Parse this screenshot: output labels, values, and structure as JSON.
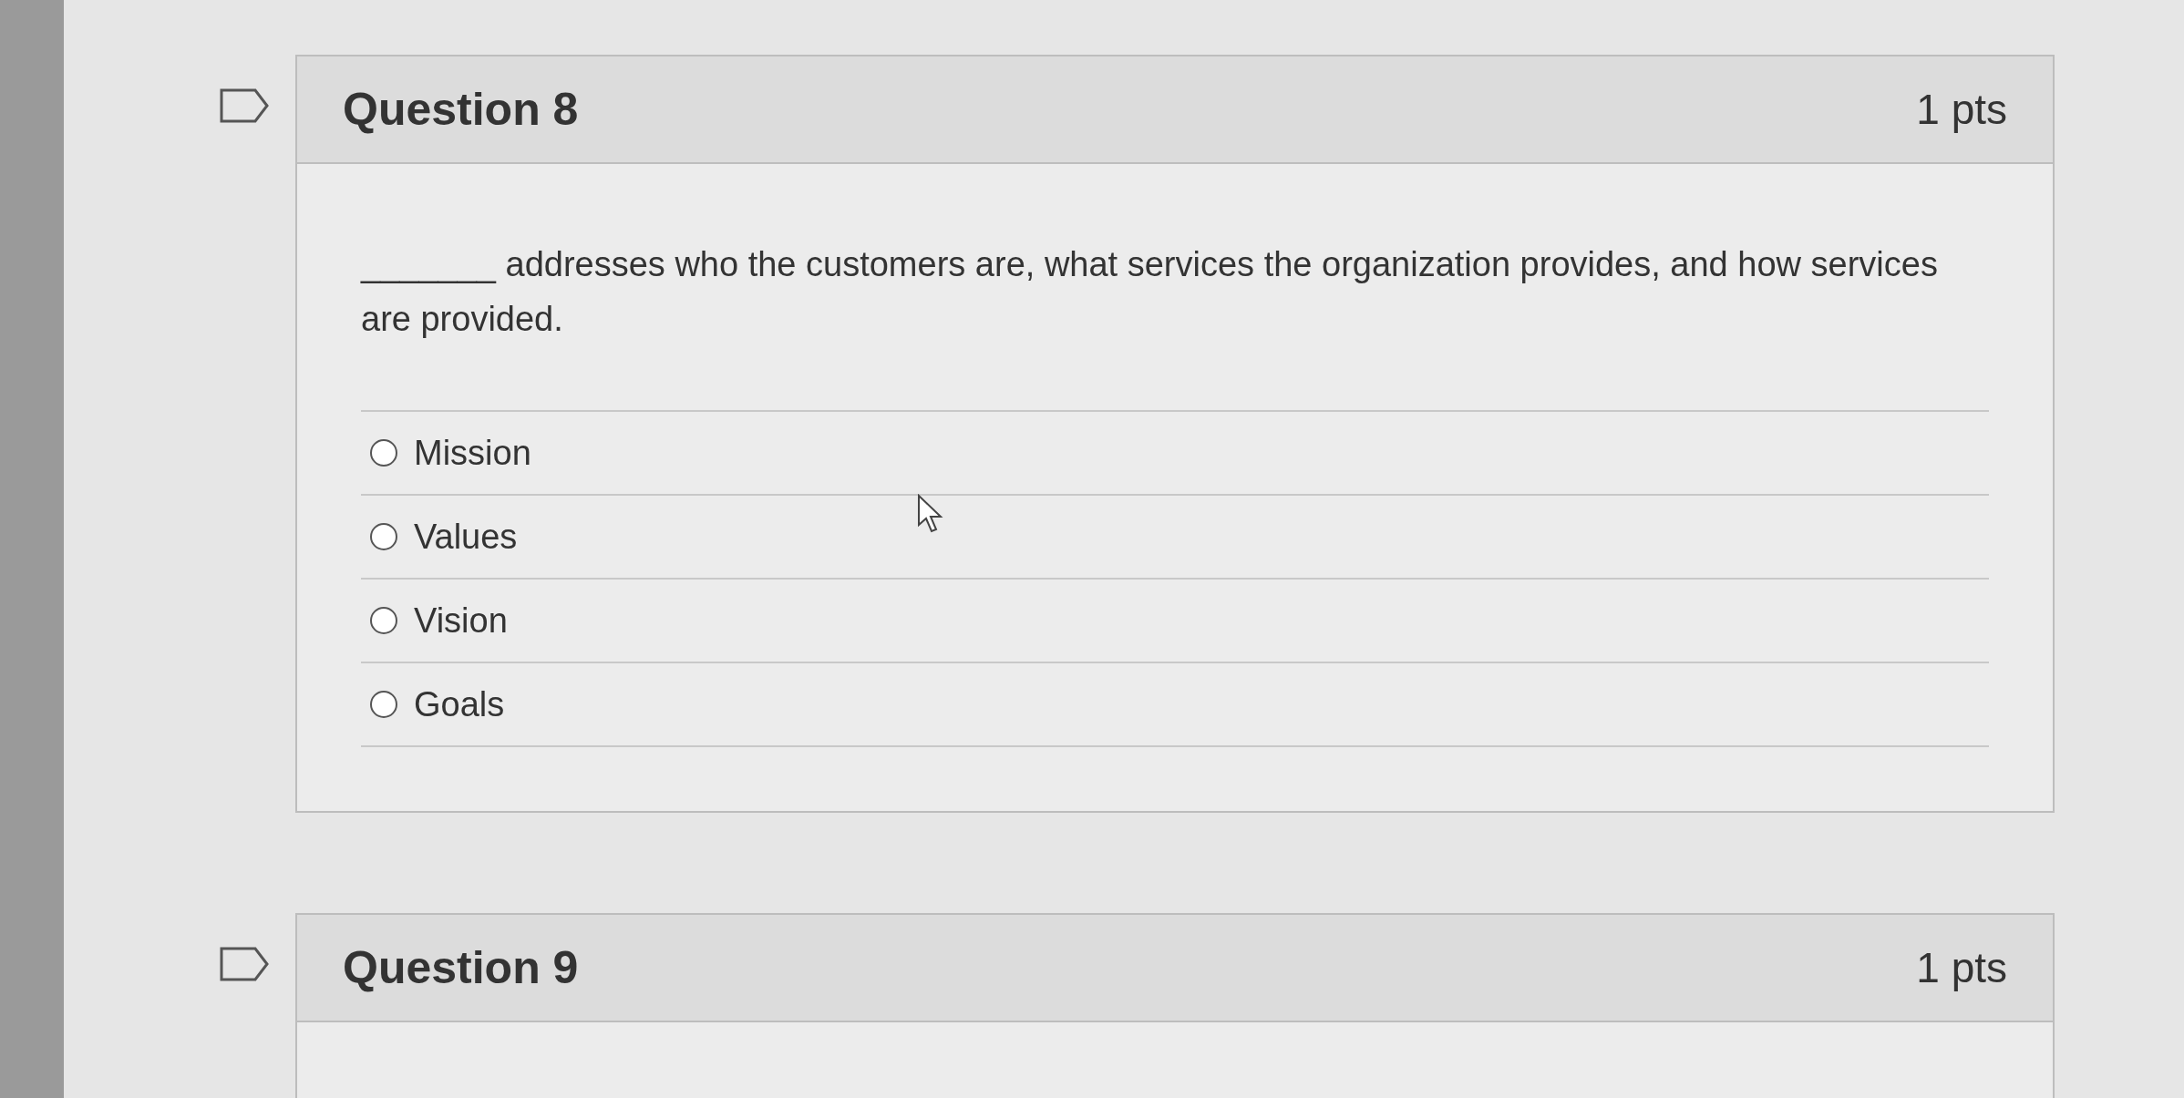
{
  "questions": [
    {
      "title": "Question 8",
      "points": "1 pts",
      "text": "_______ addresses who the customers are, what services the organization provides, and how services are provided.",
      "answers": [
        {
          "label": "Mission",
          "selected": false
        },
        {
          "label": "Values",
          "selected": false
        },
        {
          "label": "Vision",
          "selected": false
        },
        {
          "label": "Goals",
          "selected": false
        }
      ]
    },
    {
      "title": "Question 9",
      "points": "1 pts"
    }
  ]
}
